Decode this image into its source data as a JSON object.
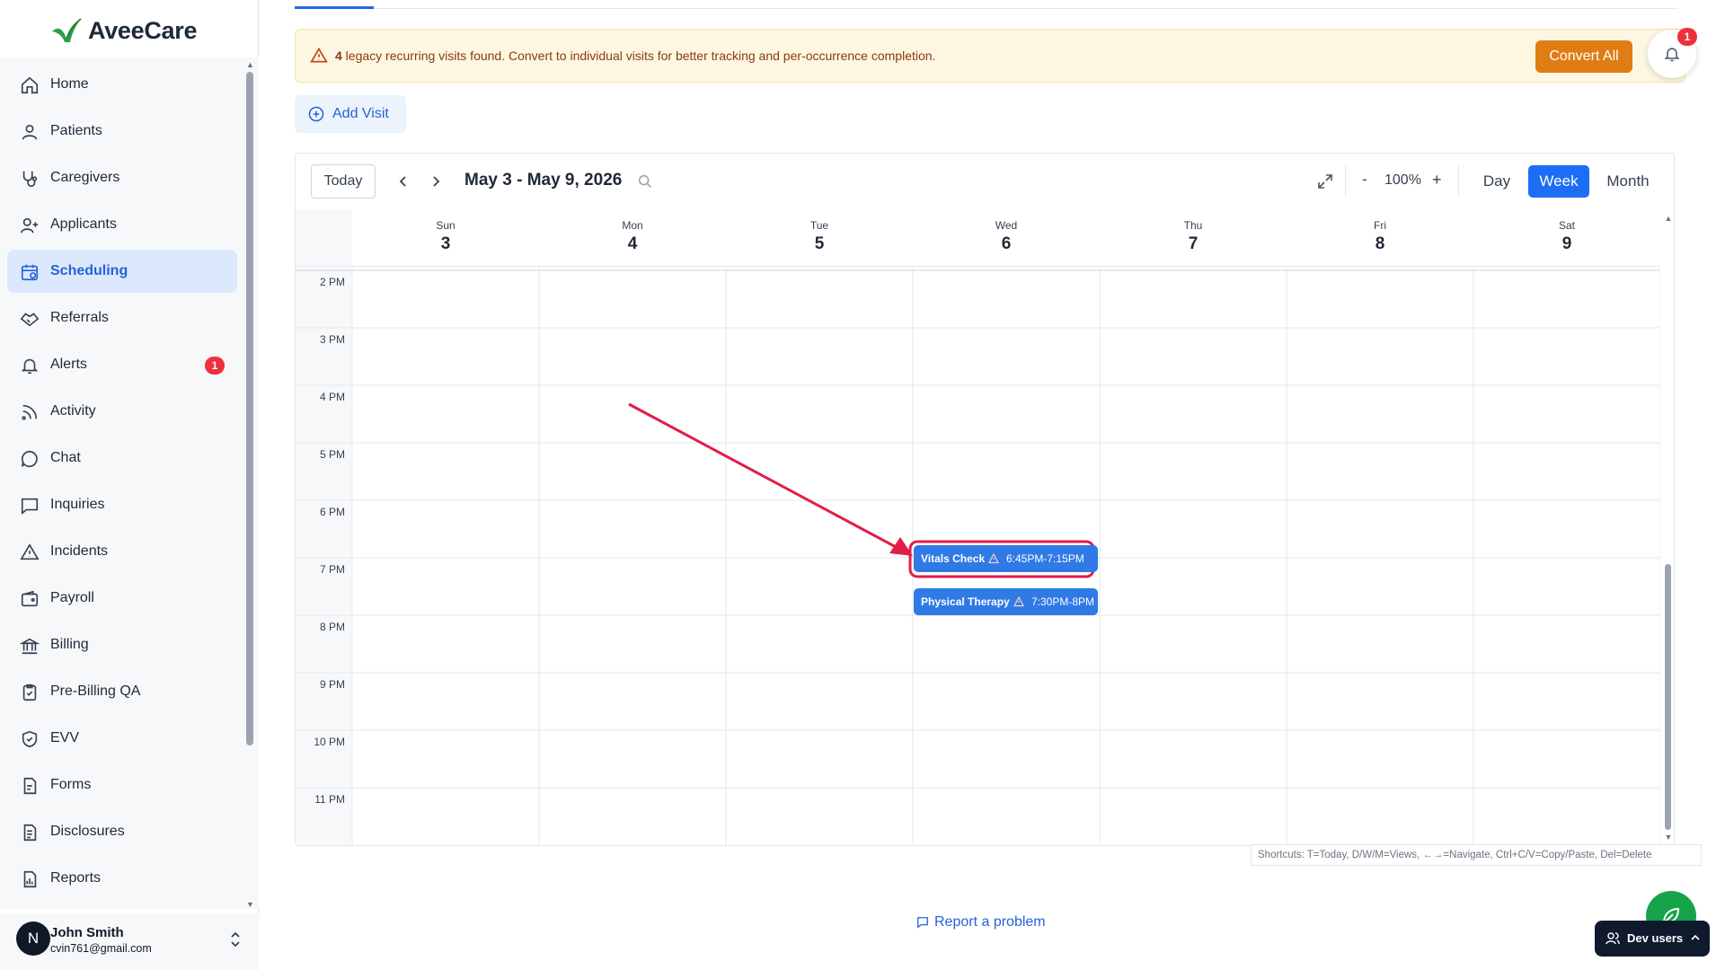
{
  "app": {
    "name": "AveeCare"
  },
  "sidebar": {
    "items": [
      {
        "label": "Home",
        "icon": "home-icon"
      },
      {
        "label": "Patients",
        "icon": "user-icon"
      },
      {
        "label": "Caregivers",
        "icon": "stethoscope-icon"
      },
      {
        "label": "Applicants",
        "icon": "user-plus-icon"
      },
      {
        "label": "Scheduling",
        "icon": "calendar-icon",
        "active": true
      },
      {
        "label": "Referrals",
        "icon": "handshake-icon"
      },
      {
        "label": "Alerts",
        "icon": "bell-icon",
        "badge": "1"
      },
      {
        "label": "Activity",
        "icon": "rss-icon"
      },
      {
        "label": "Chat",
        "icon": "chat-bubble-icon"
      },
      {
        "label": "Inquiries",
        "icon": "message-square-icon"
      },
      {
        "label": "Incidents",
        "icon": "warning-triangle-icon"
      },
      {
        "label": "Payroll",
        "icon": "wallet-icon"
      },
      {
        "label": "Billing",
        "icon": "bank-icon"
      },
      {
        "label": "Pre-Billing QA",
        "icon": "clipboard-check-icon"
      },
      {
        "label": "EVV",
        "icon": "shield-check-icon"
      },
      {
        "label": "Forms",
        "icon": "form-icon"
      },
      {
        "label": "Disclosures",
        "icon": "document-icon"
      },
      {
        "label": "Reports",
        "icon": "report-icon"
      }
    ],
    "user": {
      "initial": "N",
      "name": "John Smith",
      "email": "cvin761@gmail.com"
    }
  },
  "banner": {
    "count": "4",
    "message": " legacy recurring visits found. Convert to individual visits for better tracking and per-occurrence completion.",
    "convert_label": "Convert All",
    "notification_count": "1"
  },
  "add_visit_label": "Add Visit",
  "calendar": {
    "today_label": "Today",
    "range_label": "May 3 - May 9, 2026",
    "zoom_minus": "-",
    "zoom_level": "100%",
    "zoom_plus": "+",
    "views": [
      "Day",
      "Week",
      "Month"
    ],
    "active_view": "Week",
    "days": [
      {
        "name": "Sun",
        "date": "3"
      },
      {
        "name": "Mon",
        "date": "4"
      },
      {
        "name": "Tue",
        "date": "5"
      },
      {
        "name": "Wed",
        "date": "6"
      },
      {
        "name": "Thu",
        "date": "7"
      },
      {
        "name": "Fri",
        "date": "8"
      },
      {
        "name": "Sat",
        "date": "9"
      }
    ],
    "hours": [
      "2 PM",
      "3 PM",
      "4 PM",
      "5 PM",
      "6 PM",
      "7 PM",
      "8 PM",
      "9 PM",
      "10 PM",
      "11 PM"
    ],
    "events": [
      {
        "title": "Vitals Check",
        "time": "6:45PM-7:15PM",
        "day": "Wed",
        "highlighted": true
      },
      {
        "title": "Physical Therapy",
        "time": "7:30PM-8PM",
        "day": "Wed",
        "highlighted": false
      }
    ],
    "event_color": "#2f7ae5",
    "highlight_color": "#e11d48"
  },
  "shortcuts": "Shortcuts: T=Today, D/W/M=Views, ←→=Navigate, Ctrl+C/V=Copy/Paste, Del=Delete",
  "report_problem": "Report a problem",
  "dev_users_label": "Dev users",
  "colors": {
    "primary": "#2463d8",
    "warning_bg": "#fdf7e2",
    "convert": "#e07c14",
    "badge": "#ef2f3c"
  }
}
